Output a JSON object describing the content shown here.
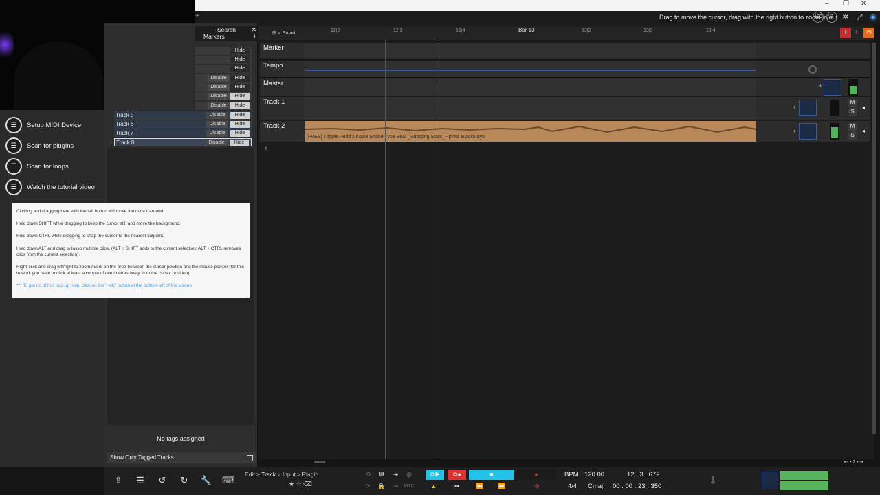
{
  "header": {
    "status_message": "Drag to move the cursor, drag with the right button to zoom in/out",
    "zoom_value": "100",
    "zoom_count": "2"
  },
  "track_panel": {
    "search_label": "Search",
    "markers_label": "Markers",
    "hide_label": "Hide",
    "disable_label": "Disable",
    "tracks": [
      "Track 5",
      "Track 6",
      "Track 7",
      "Track 8"
    ],
    "no_tags": "No tags assigned",
    "show_only_tagged": "Show Only Tagged Tracks"
  },
  "quick_actions": {
    "items": [
      {
        "label": "Setup MIDI Device",
        "icon": "midi-icon"
      },
      {
        "label": "Scan for plugins",
        "icon": "plugin-icon"
      },
      {
        "label": "Scan for loops",
        "icon": "loop-icon"
      },
      {
        "label": "Watch the tutorial video",
        "icon": "video-icon"
      }
    ]
  },
  "help_popup": {
    "p1": "Clicking and dragging here with the left button will move the cursor around.",
    "p2": "Hold down SHIFT while dragging to keep the cursor still and move the background.",
    "p3": "Hold down CTRL while dragging to snap the cursor to the nearest cutpoint.",
    "p4": "Hold down ALT and drag to lasso multiple clips. (ALT + SHIFT adds to the current selection; ALT + CTRL removes clips from the current selection).",
    "p5": "Right-click and drag left/right to zoom in/out on the area between the cursor position and the mouse pointer (for this to work you have to click at least a couple of centimetres away from the cursor position).",
    "hint": "*** To get rid of this pop-up help, click on the 'Help' button at the bottom-left of the screen."
  },
  "ruler": {
    "snap_label": "Smart",
    "marks": [
      "12|2",
      "12|3",
      "12|4",
      "Bar 13",
      "13|2",
      "13|3",
      "13|4"
    ]
  },
  "lanes": {
    "marker": "Marker",
    "tempo": "Tempo",
    "master": "Master",
    "track1": "Track 1",
    "track2": "Track 2"
  },
  "clip": {
    "title": "[FREE] Trippie Redd x Kodie Shane Type Beat _Shooting Stars_ - prod. BlackMayo",
    "color": "#b8885a"
  },
  "channel": {
    "mute": "M",
    "solo": "S"
  },
  "menu": {
    "edit": "Edit",
    "track": "Track",
    "input": "Input",
    "plugin": "Plugin"
  },
  "transport_extra": {
    "mtc": "MTC"
  },
  "tempo_info": {
    "bpm_label": "BPM",
    "bpm_value": "120.00",
    "position": "12 . 3 . 672",
    "time_sig": "4/4",
    "key": "Cmaj",
    "time": "00 : 00 : 23 . 350"
  },
  "colors": {
    "accent_cyan": "#22c3e6",
    "record_red": "#e03030",
    "clip": "#b8885a",
    "meter_green": "#4fb45a"
  }
}
